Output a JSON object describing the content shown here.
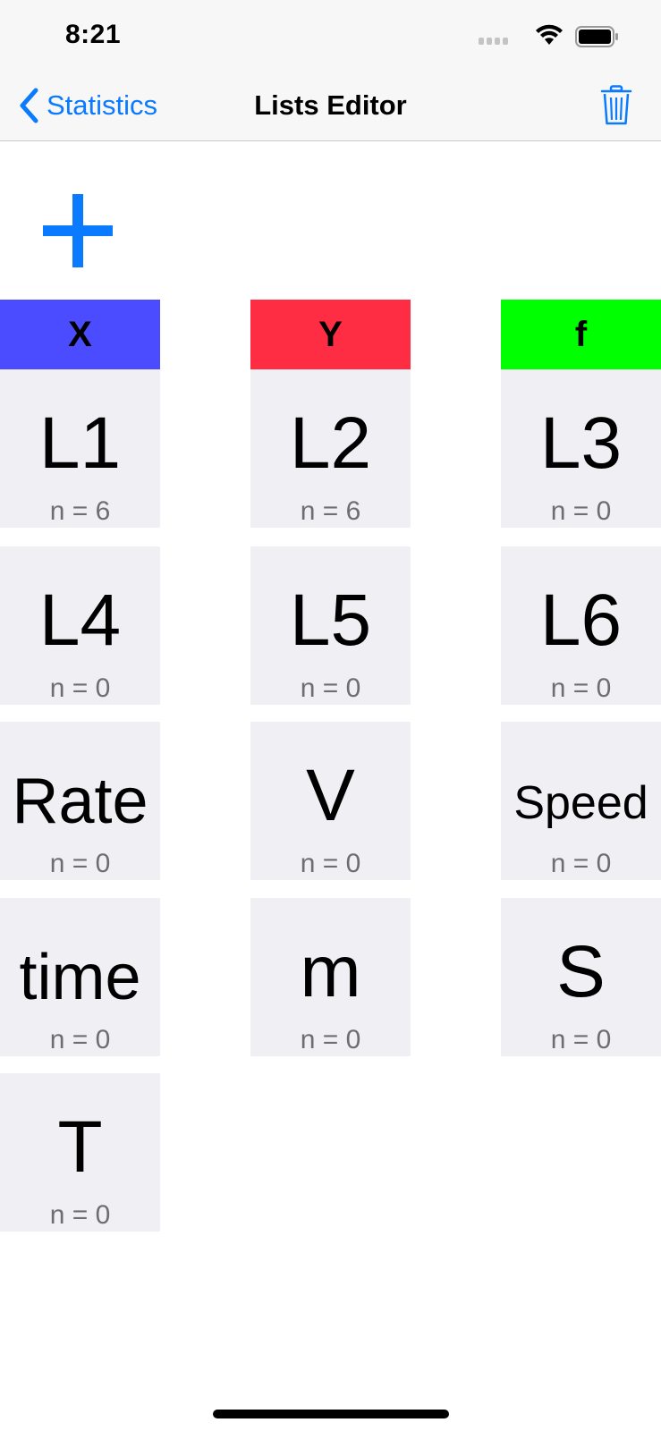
{
  "status_bar": {
    "time": "8:21"
  },
  "nav": {
    "back_label": "Statistics",
    "title": "Lists Editor"
  },
  "colors": {
    "accent": "#0a7aff",
    "x_header": "#4b4bff",
    "y_header": "#ff2d44",
    "f_header": "#00ff00",
    "tile_bg": "#efeff4"
  },
  "headers": {
    "x": "X",
    "y": "Y",
    "f": "f"
  },
  "lists": [
    {
      "name": "L1",
      "count": "n = 6"
    },
    {
      "name": "L2",
      "count": "n = 6"
    },
    {
      "name": "L3",
      "count": "n = 0"
    },
    {
      "name": "L4",
      "count": "n = 0"
    },
    {
      "name": "L5",
      "count": "n = 0"
    },
    {
      "name": "L6",
      "count": "n = 0"
    },
    {
      "name": "Rate",
      "count": "n = 0"
    },
    {
      "name": "V",
      "count": "n = 0"
    },
    {
      "name": "Speed",
      "count": "n = 0"
    },
    {
      "name": "time",
      "count": "n = 0"
    },
    {
      "name": "m",
      "count": "n = 0"
    },
    {
      "name": "S",
      "count": "n = 0"
    },
    {
      "name": "T",
      "count": "n = 0"
    }
  ]
}
